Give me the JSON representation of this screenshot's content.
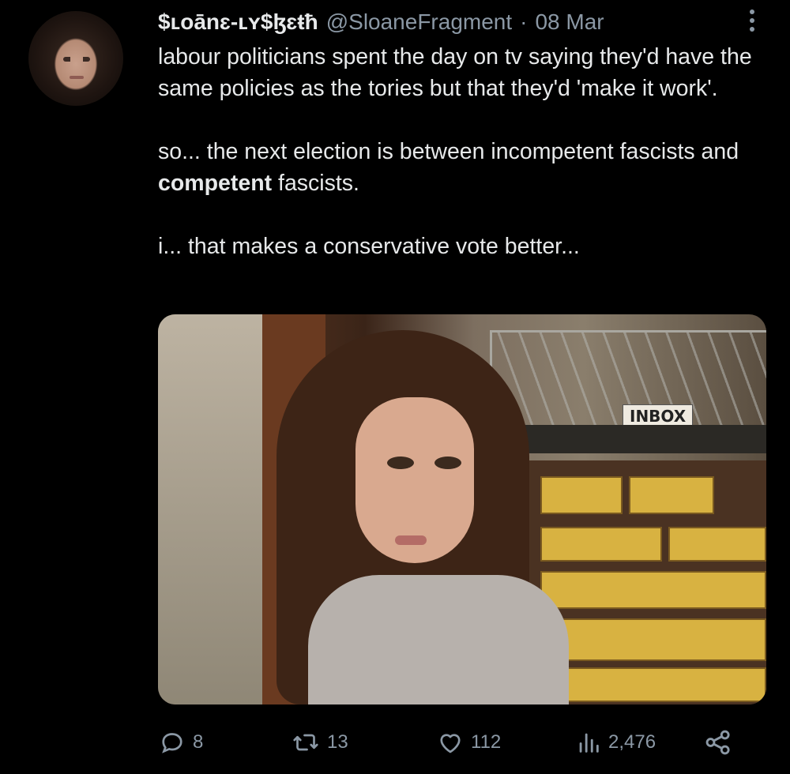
{
  "author": {
    "display_name": "$ʟoā̄nɛ-ʟʏ$ɮɛŧħ",
    "handle": "@SloaneFragment",
    "separator": "·",
    "date": "08 Mar"
  },
  "tweet": {
    "paragraph1": "labour politicians spent the day on tv saying they'd have the same policies as the tories but that they'd 'make it work'.",
    "paragraph2_before": "so... the next election is between incompetent fascists and ",
    "paragraph2_bold": "competent",
    "paragraph2_after": " fascists.",
    "paragraph3": "i... that makes a conservative vote better..."
  },
  "media": {
    "sign_text": "INBOX"
  },
  "actions": {
    "replies": "8",
    "reposts": "13",
    "likes": "112",
    "views": "2,476"
  },
  "icons": [
    "more-icon",
    "reply-icon",
    "repost-icon",
    "like-icon",
    "views-icon",
    "share-icon"
  ],
  "colors": {
    "background": "#000000",
    "text": "#e7e9ea",
    "muted": "#8b98a5"
  }
}
